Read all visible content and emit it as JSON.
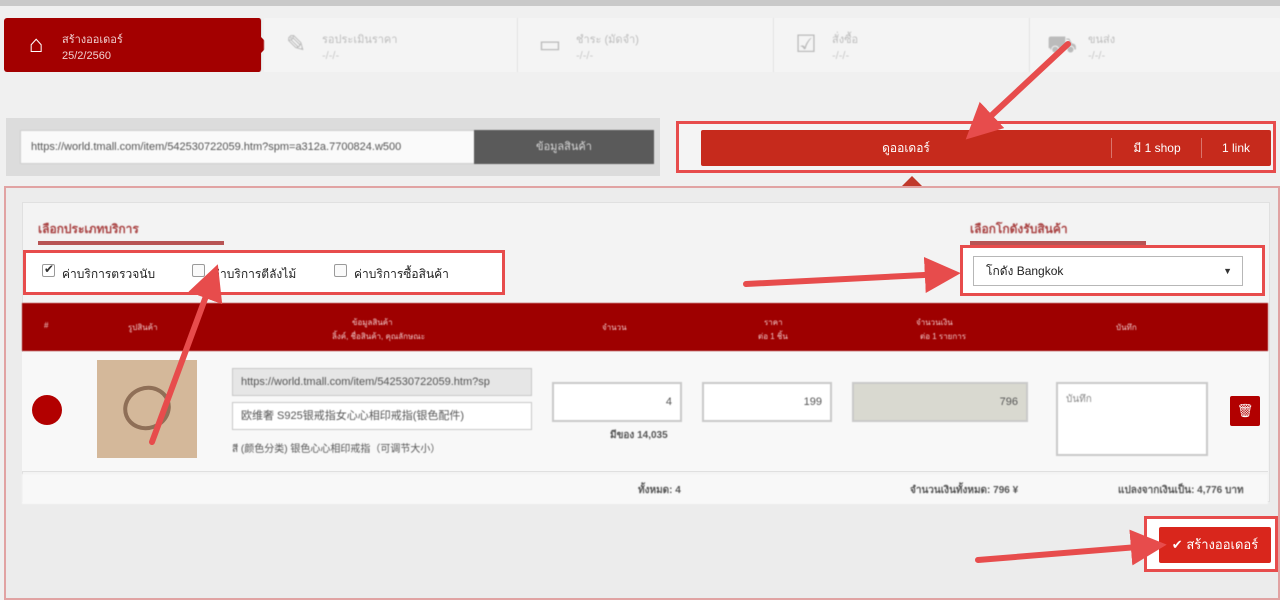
{
  "steps": [
    {
      "title": "สร้างออเดอร์",
      "date": "25/2/2560",
      "icon": "home-icon",
      "active": true
    },
    {
      "title": "รอประเมินราคา",
      "date": "-/-/-",
      "icon": "edit-icon",
      "active": false
    },
    {
      "title": "ชำระ (มัดจำ)",
      "date": "-/-/-",
      "icon": "card-icon",
      "active": false
    },
    {
      "title": "สั่งซื้อ",
      "date": "-/-/-",
      "icon": "checklist-icon",
      "active": false
    },
    {
      "title": "ขนส่ง",
      "date": "-/-/-",
      "icon": "truck-icon",
      "active": false
    }
  ],
  "url_bar": {
    "value": "https://world.tmall.com/item/542530722059.htm?spm=a312a.7700824.w500",
    "button_label": "ข้อมูลสินค้า"
  },
  "order_bar": {
    "view_label": "ดูออเดอร์",
    "shop_label": "มี 1 shop",
    "link_label": "1 link"
  },
  "service_section": {
    "title": "เลือกประเภทบริการ",
    "options": [
      {
        "label": "ค่าบริการตรวจนับ",
        "checked": true
      },
      {
        "label": "ค่าบริการตีลังไม้",
        "checked": false
      },
      {
        "label": "ค่าบริการซื้อสินค้า",
        "checked": false
      }
    ]
  },
  "warehouse_section": {
    "title": "เลือกโกดังรับสินค้า",
    "selected": "โกดัง Bangkok"
  },
  "table": {
    "headers": {
      "no": "#",
      "image": "รูปสินค้า",
      "info": "ข้อมูลสินค้า",
      "info_sub": "ลิ้งค์, ชื่อสินค้า, คุณลักษณะ",
      "qty": "จำนวน",
      "price": "ราคา",
      "price_sub": "ต่อ 1 ชิ้น",
      "total": "จำนวนเงิน",
      "total_sub": "ต่อ 1 รายการ",
      "note": "บันทึก"
    },
    "row": {
      "link": "https://world.tmall.com/item/542530722059.htm?sp",
      "name": "欧维奢 S925银戒指女心心相印戒指(银色配件)",
      "spec": "สี (颜色分类) 银色心心相印戒指（可调节大小）",
      "qty": "4",
      "stock": "มีของ 14,035",
      "price": "199",
      "total": "796",
      "note_placeholder": "บันทึก"
    },
    "footer": {
      "count": "ทั้งหมด: 4",
      "sum_yuan": "จำนวนเงินทั้งหมด: 796 ¥",
      "sum_baht": "แปลงจากเงินเป็น: 4,776 บาท"
    }
  },
  "create_button_label": "สร้างออเดอร์",
  "colors": {
    "brand_red": "#a30000",
    "button_red": "#d9261c",
    "annotation_red": "#e74c4c"
  }
}
